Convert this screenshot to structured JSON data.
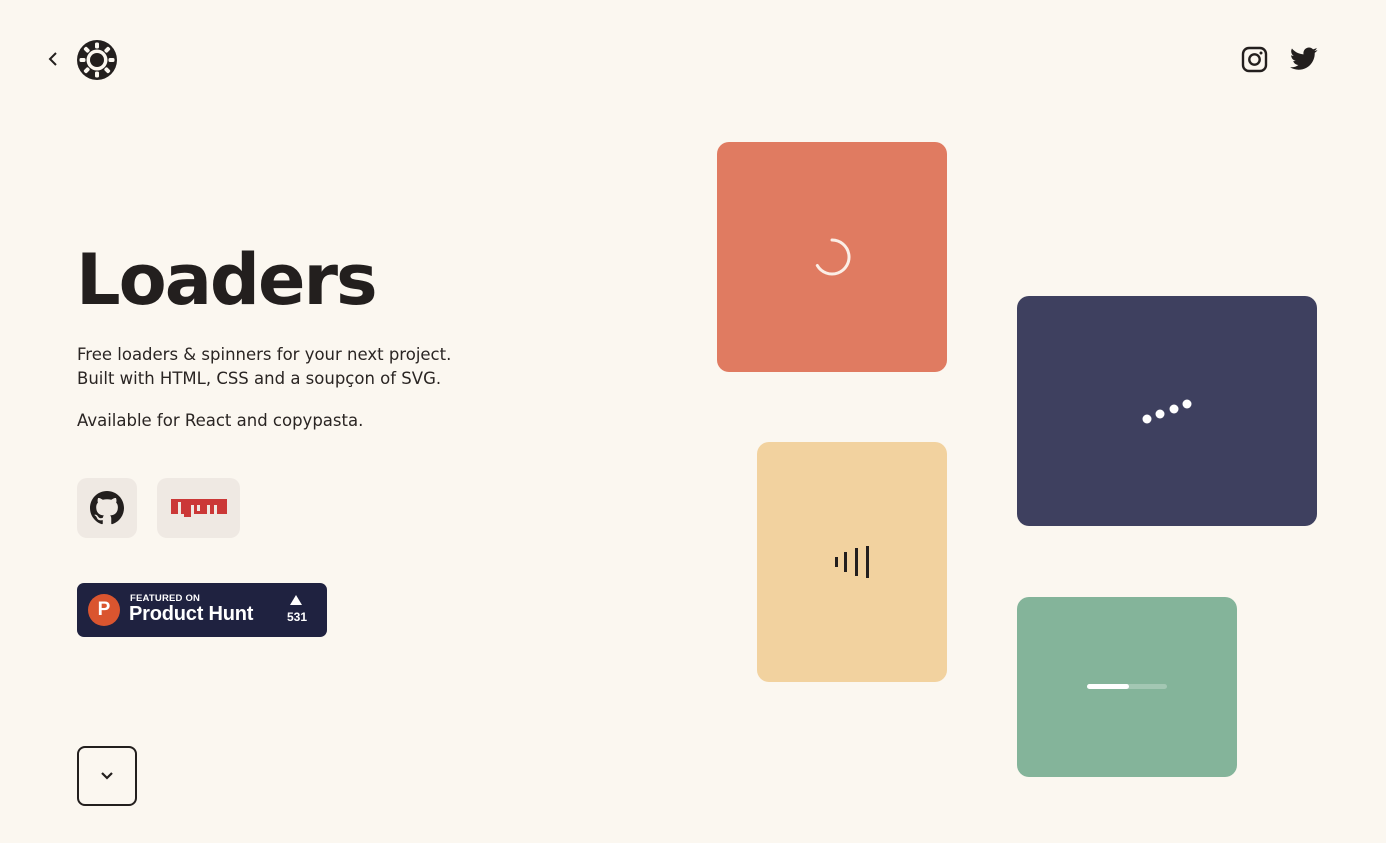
{
  "nav": {
    "back_icon": "chevron-left-icon",
    "logo_icon": "loader-wheel-logo-icon",
    "social": [
      "instagram-icon",
      "twitter-icon"
    ]
  },
  "hero": {
    "title": "Loaders",
    "description_line1": "Free loaders & spinners for your next project.",
    "description_line2": "Built with HTML, CSS and a soupçon of SVG.",
    "availability": "Available for React and copypasta.",
    "links": [
      {
        "name": "github",
        "icon": "github-icon"
      },
      {
        "name": "npm",
        "icon": "npm-logo-icon"
      }
    ],
    "product_hunt": {
      "letter": "P",
      "featured": "FEATURED ON",
      "name": "Product Hunt",
      "count": "531"
    },
    "scroll_icon": "chevron-down-icon"
  },
  "cards": [
    {
      "name": "spinner-ring",
      "color": "#e07b61"
    },
    {
      "name": "dots-wave",
      "color": "#3e405f"
    },
    {
      "name": "bars-ascending",
      "color": "#f2d29f"
    },
    {
      "name": "progress-bar",
      "color": "#84b49a",
      "progress": 0.53
    }
  ],
  "colors": {
    "background": "#fbf7f0",
    "text": "#231f1e",
    "product_hunt_bg": "#1f2240",
    "product_hunt_orange": "#da552f",
    "npm_red": "#cb3837"
  }
}
